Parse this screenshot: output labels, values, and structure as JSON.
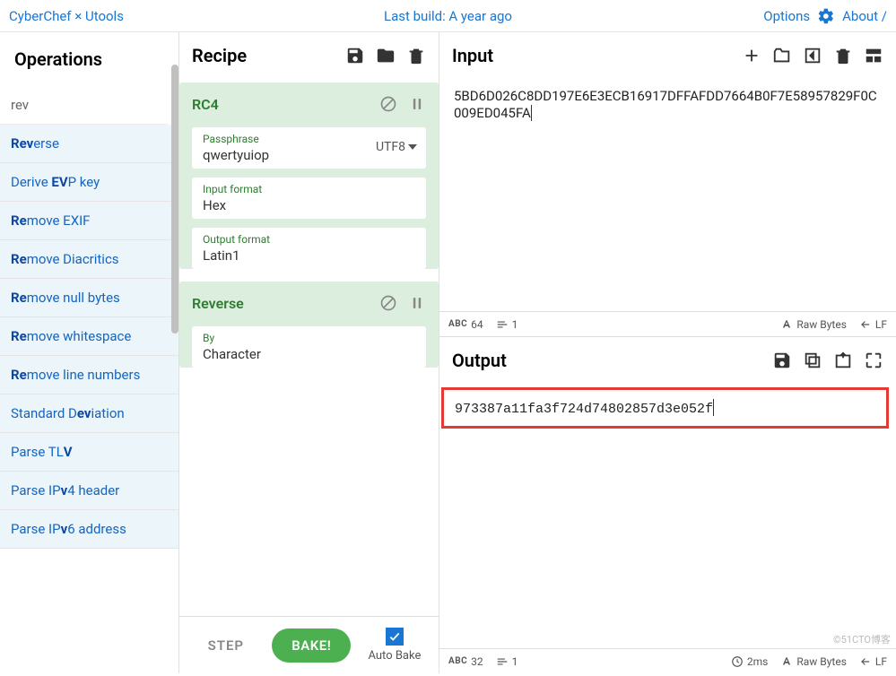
{
  "header": {
    "left": "CyberChef × Utools",
    "center": "Last build: A year ago",
    "options": "Options",
    "about": "About /"
  },
  "panels": {
    "operations": "Operations",
    "recipe": "Recipe",
    "input": "Input",
    "output": "Output"
  },
  "search": {
    "value": "rev"
  },
  "ops": [
    {
      "pre": "Rev",
      "rest": "erse"
    },
    {
      "pre": "",
      "text": "Derive ",
      "b": "EV",
      "rest": "P key"
    },
    {
      "pre": "Re",
      "rest": "move EXIF"
    },
    {
      "pre": "Re",
      "rest": "move Diacritics"
    },
    {
      "pre": "Re",
      "rest": "move null bytes"
    },
    {
      "pre": "Re",
      "rest": "move whitespace"
    },
    {
      "pre": "Re",
      "rest": "move line numbers"
    },
    {
      "pre": "",
      "text": "Standard D",
      "b": "ev",
      "rest": "iation"
    },
    {
      "pre": "",
      "text": "Parse TL",
      "b": "V",
      "rest": ""
    },
    {
      "pre": "",
      "text": "Parse IP",
      "b": "v",
      "rest": "4 header"
    },
    {
      "pre": "",
      "text": "Parse IP",
      "b": "v",
      "rest": "6 address"
    }
  ],
  "recipe": {
    "rc4": {
      "title": "RC4",
      "passphrase_label": "Passphrase",
      "passphrase_value": "qwertyuiop",
      "passphrase_enc": "UTF8",
      "input_format_label": "Input format",
      "input_format_value": "Hex",
      "output_format_label": "Output format",
      "output_format_value": "Latin1"
    },
    "reverse": {
      "title": "Reverse",
      "by_label": "By",
      "by_value": "Character"
    }
  },
  "footer": {
    "step": "STEP",
    "bake": "BAKE!",
    "autobake": "Auto Bake"
  },
  "input": {
    "text": "5BD6D026C8DD197E6E3ECB16917DFFAFDD7664B0F7E58957829F0C009ED045FA"
  },
  "output": {
    "text": "973387a11fa3f724d74802857d3e052f"
  },
  "status_input": {
    "chars": "64",
    "lines": "1",
    "case": "Raw Bytes",
    "lf": "LF"
  },
  "status_output": {
    "chars": "32",
    "lines": "1",
    "time": "2ms",
    "case": "Raw Bytes",
    "lf": "LF"
  },
  "watermark": "©51CTO博客"
}
